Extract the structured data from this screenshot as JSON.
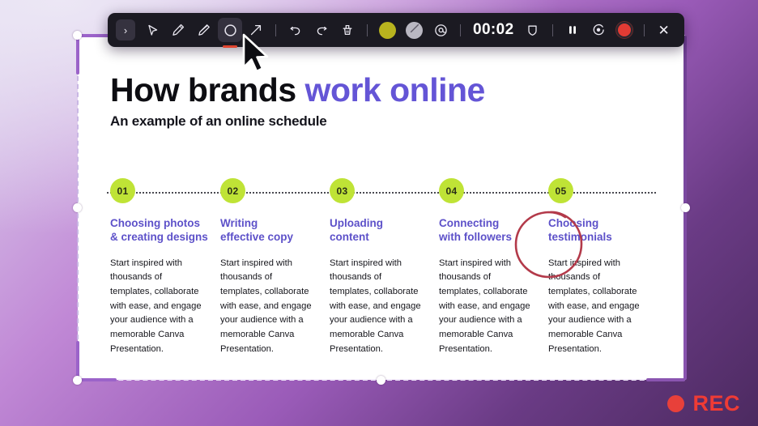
{
  "toolbar": {
    "expander_label": "›",
    "tools": [
      {
        "name": "select-tool",
        "icon": "cursor-arrow-icon",
        "active": false
      },
      {
        "name": "pen-tool",
        "icon": "pen-icon",
        "active": false
      },
      {
        "name": "highlighter-tool",
        "icon": "highlighter-icon",
        "active": false
      },
      {
        "name": "shape-tool",
        "icon": "circle-shape-icon",
        "active": true
      },
      {
        "name": "arrow-tool",
        "icon": "arrow-up-right-icon",
        "active": false
      }
    ],
    "history": [
      {
        "name": "undo-button",
        "icon": "undo-icon"
      },
      {
        "name": "redo-button",
        "icon": "redo-icon"
      },
      {
        "name": "clear-all-button",
        "icon": "eraser-broom-icon"
      }
    ],
    "color_swatch": "#b8b31e",
    "stroke_label": "stroke-width-icon",
    "mention_label": "at-mention-icon",
    "timer": "00:02",
    "shield_label": "shield-icon",
    "pause_label": "pause-icon",
    "restart_label": "restart-icon",
    "record_label": "record-button",
    "close_label": "✕"
  },
  "slide": {
    "title_black": "How brands",
    "title_purple": "work online",
    "subtitle": "An example of an online schedule",
    "body_text": "Start inspired with thousands of templates, collaborate with ease, and engage your audience with a memorable Canva Presentation.",
    "steps": [
      {
        "number": "01",
        "heading": "Choosing photos\n& creating designs"
      },
      {
        "number": "02",
        "heading": "Writing\neffective copy"
      },
      {
        "number": "03",
        "heading": "Uploading\ncontent"
      },
      {
        "number": "04",
        "heading": "Connecting\nwith followers"
      },
      {
        "number": "05",
        "heading": "Choosing\ntestimonials"
      }
    ],
    "colors": {
      "badge": "#bfe336",
      "heading": "#5d51c9",
      "title_accent": "#6455d6",
      "annotation": "#b33a4a"
    }
  },
  "recording": {
    "label": "REC",
    "dot_color": "#e8403a"
  }
}
